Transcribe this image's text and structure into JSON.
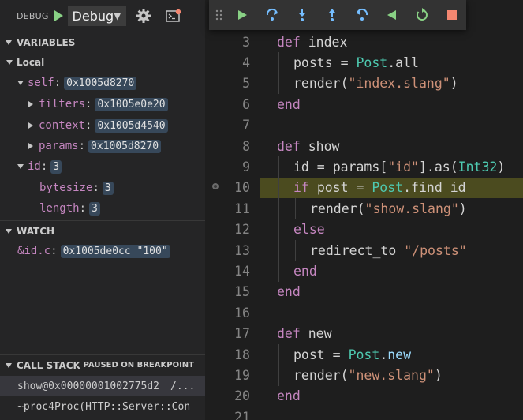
{
  "debug_toolbar": {
    "title": "DEBUG",
    "configuration": "Debug",
    "colors": {
      "start": "#89d185",
      "console_badge": "#f48771"
    }
  },
  "variables": {
    "header": "VARIABLES",
    "scope_label": "Local",
    "items": [
      {
        "name": "self",
        "value": "0x1005d8270",
        "expanded": true
      },
      {
        "name": "filters",
        "value": "0x1005e0e20",
        "expanded": false
      },
      {
        "name": "context",
        "value": "0x1005d4540",
        "expanded": false
      },
      {
        "name": "params",
        "value": "0x1005d8270",
        "expanded": false
      },
      {
        "name": "id",
        "value": "3",
        "expanded": true
      },
      {
        "name": "bytesize",
        "value": "3"
      },
      {
        "name": "length",
        "value": "3"
      }
    ]
  },
  "watch": {
    "header": "WATCH",
    "items": [
      {
        "expression": "&id.c",
        "value": "0x1005de0cc \"100\""
      }
    ]
  },
  "call_stack": {
    "header": "CALL STACK",
    "status": "PAUSED ON BREAKPOINT",
    "frames": [
      {
        "label": "show@0x00000001002775d2",
        "file": "/..."
      },
      {
        "label": "~proc4Proc(HTTP::Server::Con",
        "file": ""
      }
    ]
  },
  "editor": {
    "current_line": 10,
    "highlight_color": "#4b4b1f",
    "line_numbers": [
      "3",
      "4",
      "5",
      "6",
      "7",
      "8",
      "9",
      "10",
      "11",
      "12",
      "13",
      "14",
      "15",
      "16",
      "17",
      "18",
      "19",
      "20",
      "21"
    ]
  },
  "float_toolbar": {
    "buttons": [
      {
        "name": "continue",
        "icon": "play-icon",
        "color": "#89d185"
      },
      {
        "name": "step-over",
        "icon": "step-over-icon",
        "color": "#75beff"
      },
      {
        "name": "step-into",
        "icon": "step-into-icon",
        "color": "#75beff"
      },
      {
        "name": "step-out",
        "icon": "step-out-icon",
        "color": "#75beff"
      },
      {
        "name": "step-back",
        "icon": "step-back-icon",
        "color": "#75beff"
      },
      {
        "name": "reverse",
        "icon": "reverse-continue-icon",
        "color": "#89d185"
      },
      {
        "name": "restart",
        "icon": "restart-icon",
        "color": "#89d185"
      },
      {
        "name": "stop",
        "icon": "stop-icon",
        "color": "#f48771"
      }
    ]
  },
  "code": {
    "l3": {
      "kw": "def",
      "name": "index"
    },
    "l4": {
      "var": "posts",
      "op": " = ",
      "cls": "Post",
      "rest": ".all"
    },
    "l5": {
      "fn": "render",
      "open": "(",
      "str": "\"index.slang\"",
      "close": ")"
    },
    "l6": {
      "kw": "end"
    },
    "l8": {
      "kw": "def",
      "name": "show"
    },
    "l9": {
      "var": "id",
      "op": " = ",
      "fn": "params",
      "open": "[",
      "str": "\"id\"",
      "mid": "].as(",
      "cls": "Int32",
      "close": ")"
    },
    "l10": {
      "kw": "if",
      "var": "post",
      "op": " = ",
      "cls": "Post",
      "rest": ".find id"
    },
    "l11": {
      "fn": "render",
      "open": "(",
      "str": "\"show.slang\"",
      "close": ")"
    },
    "l12": {
      "kw": "else"
    },
    "l13": {
      "fn": "redirect_to",
      "str": "\"/posts\""
    },
    "l14": {
      "kw": "end"
    },
    "l15": {
      "kw": "end"
    },
    "l17": {
      "kw": "def",
      "name": "new"
    },
    "l18": {
      "var": "post",
      "op": " = ",
      "cls": "Post",
      "rest": ".",
      "method": "new"
    },
    "l19": {
      "fn": "render",
      "open": "(",
      "str": "\"new.slang\"",
      "close": ")"
    },
    "l20": {
      "kw": "end"
    }
  }
}
